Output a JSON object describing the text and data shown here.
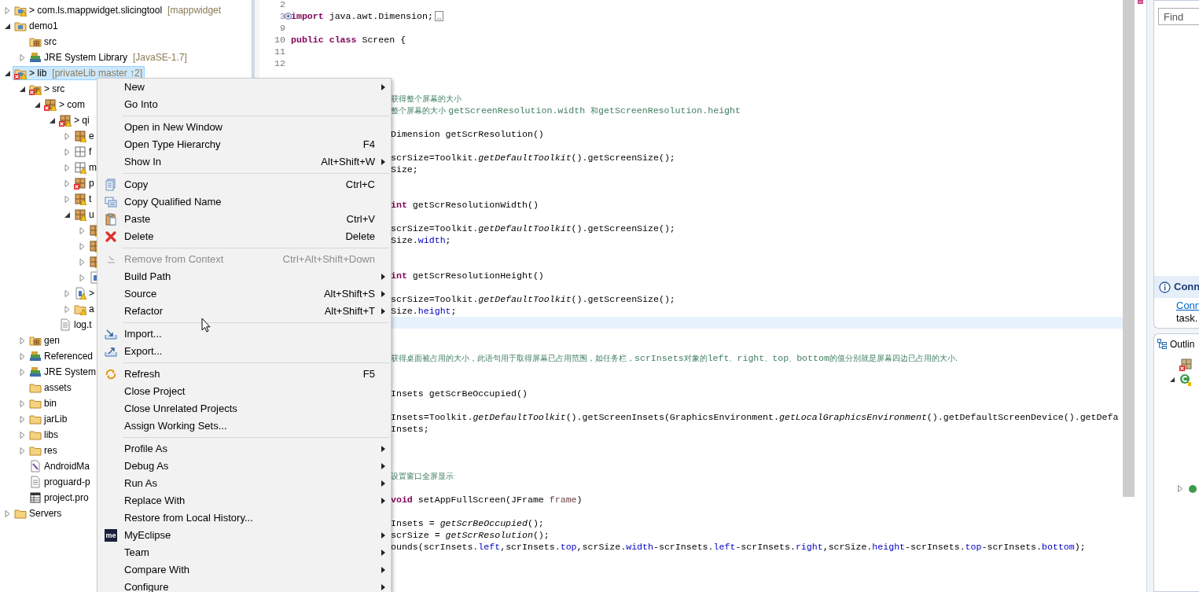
{
  "tree": {
    "items": [
      {
        "label": "> com.ls.mappwidget.slicingtool",
        "decoration": "[mappwidget",
        "kind": "project",
        "expandable": true,
        "expanded": false,
        "selected": false,
        "error": false,
        "warning": true
      },
      {
        "label": "demo1",
        "kind": "project",
        "expandable": true,
        "expanded": true,
        "selected": false,
        "error": false,
        "warning": false,
        "children": [
          {
            "label": "src",
            "kind": "source-folder",
            "expandable": false,
            "expanded": false,
            "selected": false,
            "error": false,
            "warning": false
          },
          {
            "label": "JRE System Library",
            "decoration": "[JavaSE-1.7]",
            "kind": "library",
            "expandable": true,
            "expanded": false,
            "selected": false,
            "error": false,
            "warning": false
          }
        ]
      },
      {
        "label": "> lib",
        "decoration": "[privateLib master ↑2]",
        "kind": "project",
        "expandable": true,
        "expanded": true,
        "selected": true,
        "error": true,
        "warning": true,
        "children": [
          {
            "label": "> src",
            "kind": "source-folder",
            "expandable": true,
            "expanded": true,
            "selected": false,
            "error": true,
            "warning": true,
            "children": [
              {
                "label": "> com",
                "kind": "package",
                "expandable": true,
                "expanded": true,
                "selected": false,
                "error": true,
                "warning": true,
                "children": [
                  {
                    "label": "> qi",
                    "kind": "package",
                    "expandable": true,
                    "expanded": true,
                    "selected": false,
                    "error": true,
                    "warning": true,
                    "children": [
                      {
                        "label": "e",
                        "kind": "package",
                        "expandable": true,
                        "expanded": false,
                        "selected": false,
                        "error": false,
                        "warning": true
                      },
                      {
                        "label": "f",
                        "kind": "empty-package",
                        "expandable": true,
                        "expanded": false,
                        "selected": false,
                        "error": false,
                        "warning": false
                      },
                      {
                        "label": "m",
                        "kind": "empty-package",
                        "expandable": true,
                        "expanded": false,
                        "selected": false,
                        "error": false,
                        "warning": true
                      },
                      {
                        "label": "p",
                        "kind": "package",
                        "expandable": true,
                        "expanded": false,
                        "selected": false,
                        "error": true,
                        "warning": false
                      },
                      {
                        "label": "t",
                        "kind": "package",
                        "expandable": true,
                        "expanded": false,
                        "selected": false,
                        "error": false,
                        "warning": true
                      },
                      {
                        "label": "u",
                        "kind": "package",
                        "expandable": true,
                        "expanded": true,
                        "selected": false,
                        "error": false,
                        "warning": true,
                        "children": [
                          {
                            "kind": "package",
                            "expandable": true,
                            "expanded": false,
                            "selected": false,
                            "error": false,
                            "warning": true
                          },
                          {
                            "kind": "package",
                            "expandable": true,
                            "expanded": false,
                            "selected": false,
                            "error": false,
                            "warning": true
                          },
                          {
                            "kind": "package",
                            "expandable": true,
                            "expanded": false,
                            "selected": false,
                            "error": false,
                            "warning": true
                          },
                          {
                            "kind": "java-file",
                            "expandable": true,
                            "expanded": false,
                            "selected": false,
                            "error": false,
                            "warning": false
                          }
                        ]
                      },
                      {
                        "label": ">",
                        "kind": "java-file",
                        "expandable": true,
                        "expanded": false,
                        "selected": false,
                        "error": false,
                        "warning": true
                      },
                      {
                        "label": "a",
                        "kind": "folder",
                        "expandable": true,
                        "expanded": false,
                        "selected": false,
                        "error": false,
                        "warning": true
                      }
                    ]
                  },
                  {
                    "label": "log.t",
                    "kind": "file",
                    "expandable": false,
                    "expanded": false,
                    "selected": false,
                    "error": false,
                    "warning": false
                  }
                ]
              }
            ]
          },
          {
            "label": "gen",
            "kind": "source-folder",
            "expandable": true,
            "expanded": false,
            "selected": false,
            "error": false,
            "warning": false
          },
          {
            "label": "Referenced",
            "kind": "library",
            "expandable": true,
            "expanded": false,
            "selected": false,
            "error": false,
            "warning": false
          },
          {
            "label": "JRE System",
            "kind": "library",
            "expandable": true,
            "expanded": false,
            "selected": false,
            "error": false,
            "warning": false
          },
          {
            "label": "assets",
            "kind": "folder",
            "expandable": false,
            "expanded": false,
            "selected": false,
            "error": false,
            "warning": false
          },
          {
            "label": "bin",
            "kind": "folder",
            "expandable": true,
            "expanded": false,
            "selected": false,
            "error": false,
            "warning": false
          },
          {
            "label": "jarLib",
            "kind": "folder",
            "expandable": true,
            "expanded": false,
            "selected": false,
            "error": false,
            "warning": false
          },
          {
            "label": "libs",
            "kind": "folder",
            "expandable": true,
            "expanded": false,
            "selected": false,
            "error": false,
            "warning": false
          },
          {
            "label": "res",
            "kind": "folder",
            "expandable": true,
            "expanded": false,
            "selected": false,
            "error": false,
            "warning": false
          },
          {
            "label": "AndroidMa",
            "kind": "xml-file",
            "expandable": false,
            "expanded": false,
            "selected": false,
            "error": false,
            "warning": false
          },
          {
            "label": "proguard-p",
            "kind": "file",
            "expandable": false,
            "expanded": false,
            "selected": false,
            "error": false,
            "warning": false
          },
          {
            "label": "project.pro",
            "kind": "properties-file",
            "expandable": false,
            "expanded": false,
            "selected": false,
            "error": false,
            "warning": false
          }
        ]
      },
      {
        "label": "Servers",
        "kind": "folder",
        "expandable": true,
        "expanded": false,
        "selected": false,
        "error": false,
        "warning": false
      }
    ]
  },
  "editor": {
    "rows": [
      {
        "kind": "text",
        "number": "2"
      },
      {
        "kind": "folded",
        "number": "3",
        "code": [
          {
            "text": "import",
            "kind": "keyword"
          },
          {
            "text": " java.awt.Dimension;",
            "kind": "plain"
          }
        ]
      },
      {
        "kind": "text",
        "number": "9"
      },
      {
        "kind": "text",
        "number": "10",
        "code": [
          {
            "text": "public",
            "kind": "keyword"
          },
          {
            "text": " class",
            "kind": "keyword"
          },
          {
            "text": " Screen {",
            "kind": "plain"
          }
        ]
      },
      {
        "kind": "text",
        "number": "11"
      },
      {
        "kind": "text",
        "number": "12"
      },
      {
        "kind": "text"
      },
      {
        "kind": "text"
      },
      {
        "kind": "text",
        "code": [
          {
            "text": "获得整个屏幕的大小",
            "kind": "comment-cjk"
          }
        ]
      },
      {
        "kind": "text",
        "code": [
          {
            "text": "整个屏幕的大小 ",
            "kind": "comment-cjk"
          },
          {
            "text": "getScreenResolution.width ",
            "kind": "comment"
          },
          {
            "text": "和",
            "kind": "comment-cjk"
          },
          {
            "text": "getScreenResolution.height",
            "kind": "comment"
          }
        ]
      },
      {
        "kind": "text"
      },
      {
        "kind": "text",
        "code": [
          {
            "text": "Dimension getScrResolution()",
            "kind": "plain"
          }
        ]
      },
      {
        "kind": "text"
      },
      {
        "kind": "text",
        "code": [
          {
            "text": "scrSize=Toolkit.",
            "kind": "plain"
          },
          {
            "text": "getDefaultToolkit",
            "kind": "static-call"
          },
          {
            "text": "().getScreenSize();",
            "kind": "plain"
          }
        ]
      },
      {
        "kind": "text",
        "code": [
          {
            "text": "Size;",
            "kind": "plain"
          }
        ]
      },
      {
        "kind": "text"
      },
      {
        "kind": "text"
      },
      {
        "kind": "text",
        "code": [
          {
            "text": "int",
            "kind": "keyword"
          },
          {
            "text": " getScrResolutionWidth()",
            "kind": "plain"
          }
        ]
      },
      {
        "kind": "text"
      },
      {
        "kind": "text",
        "code": [
          {
            "text": "scrSize=Toolkit.",
            "kind": "plain"
          },
          {
            "text": "getDefaultToolkit",
            "kind": "static-call"
          },
          {
            "text": "().getScreenSize();",
            "kind": "plain"
          }
        ]
      },
      {
        "kind": "text",
        "code": [
          {
            "text": "Size.",
            "kind": "plain"
          },
          {
            "text": "width",
            "kind": "field"
          },
          {
            "text": ";",
            "kind": "plain"
          }
        ]
      },
      {
        "kind": "text"
      },
      {
        "kind": "text"
      },
      {
        "kind": "text",
        "code": [
          {
            "text": "int",
            "kind": "keyword"
          },
          {
            "text": " getScrResolutionHeight()",
            "kind": "plain"
          }
        ]
      },
      {
        "kind": "text"
      },
      {
        "kind": "text",
        "code": [
          {
            "text": "scrSize=Toolkit.",
            "kind": "plain"
          },
          {
            "text": "getDefaultToolkit",
            "kind": "static-call"
          },
          {
            "text": "().getScreenSize();",
            "kind": "plain"
          }
        ]
      },
      {
        "kind": "text",
        "code": [
          {
            "text": "Size.",
            "kind": "plain"
          },
          {
            "text": "height",
            "kind": "field"
          },
          {
            "text": ";",
            "kind": "plain"
          }
        ]
      },
      {
        "kind": "current"
      },
      {
        "kind": "text"
      },
      {
        "kind": "text"
      },
      {
        "kind": "text",
        "code": [
          {
            "text": "获得桌面被占用的大小，此语句用于取得屏幕已占用范围，如任务栏，",
            "kind": "comment-cjk"
          },
          {
            "text": "scrInsets",
            "kind": "comment"
          },
          {
            "text": "对象的",
            "kind": "comment-cjk"
          },
          {
            "text": "left",
            "kind": "comment"
          },
          {
            "text": "、",
            "kind": "comment-cjk"
          },
          {
            "text": "right",
            "kind": "comment"
          },
          {
            "text": "、",
            "kind": "comment-cjk"
          },
          {
            "text": "top",
            "kind": "comment"
          },
          {
            "text": "、",
            "kind": "comment-cjk"
          },
          {
            "text": "bottom",
            "kind": "comment"
          },
          {
            "text": "的值分别就是屏幕四边已占用的大小.",
            "kind": "comment-cjk"
          }
        ]
      },
      {
        "kind": "text"
      },
      {
        "kind": "text"
      },
      {
        "kind": "text",
        "code": [
          {
            "text": "Insets getScrBeOccupied()",
            "kind": "plain"
          }
        ]
      },
      {
        "kind": "text"
      },
      {
        "kind": "text",
        "code": [
          {
            "text": "Insets=Toolkit.",
            "kind": "plain"
          },
          {
            "text": "getDefaultToolkit",
            "kind": "static-call"
          },
          {
            "text": "().getScreenInsets(GraphicsEnvironment.",
            "kind": "plain"
          },
          {
            "text": "getLocalGraphicsEnvironment",
            "kind": "static-call"
          },
          {
            "text": "().getDefaultScreenDevice().getDefa",
            "kind": "plain"
          }
        ]
      },
      {
        "kind": "text",
        "code": [
          {
            "text": "Insets;",
            "kind": "plain"
          }
        ]
      },
      {
        "kind": "text"
      },
      {
        "kind": "text"
      },
      {
        "kind": "text"
      },
      {
        "kind": "text",
        "code": [
          {
            "text": "设置窗口全屏显示",
            "kind": "comment-cjk"
          }
        ]
      },
      {
        "kind": "text"
      },
      {
        "kind": "text",
        "code": [
          {
            "text": "void",
            "kind": "keyword"
          },
          {
            "text": " setAppFullScreen(JFrame ",
            "kind": "plain"
          },
          {
            "text": "frame",
            "kind": "param"
          },
          {
            "text": ")",
            "kind": "plain"
          }
        ]
      },
      {
        "kind": "text"
      },
      {
        "kind": "text",
        "code": [
          {
            "text": "Insets = ",
            "kind": "plain"
          },
          {
            "text": "getScrBeOccupied",
            "kind": "static-call"
          },
          {
            "text": "();",
            "kind": "plain"
          }
        ]
      },
      {
        "kind": "text",
        "code": [
          {
            "text": "scrSize = ",
            "kind": "plain"
          },
          {
            "text": "getScrResolution",
            "kind": "static-call"
          },
          {
            "text": "();",
            "kind": "plain"
          }
        ]
      },
      {
        "kind": "text",
        "code": [
          {
            "text": "ounds(scrInsets.",
            "kind": "plain"
          },
          {
            "text": "left",
            "kind": "field"
          },
          {
            "text": ",scrInsets.",
            "kind": "plain"
          },
          {
            "text": "top",
            "kind": "field"
          },
          {
            "text": ",scrSize.",
            "kind": "plain"
          },
          {
            "text": "width",
            "kind": "field"
          },
          {
            "text": "-scrInsets.",
            "kind": "plain"
          },
          {
            "text": "left",
            "kind": "field"
          },
          {
            "text": "-scrInsets.",
            "kind": "plain"
          },
          {
            "text": "right",
            "kind": "field"
          },
          {
            "text": ",scrSize.",
            "kind": "plain"
          },
          {
            "text": "height",
            "kind": "field"
          },
          {
            "text": "-scrInsets.",
            "kind": "plain"
          },
          {
            "text": "top",
            "kind": "field"
          },
          {
            "text": "-scrInsets.",
            "kind": "plain"
          },
          {
            "text": "bottom",
            "kind": "field"
          },
          {
            "text": ");",
            "kind": "plain"
          }
        ]
      }
    ]
  },
  "context_menu": {
    "groups": [
      [
        {
          "label": "New",
          "kind": "plain",
          "submenu": true,
          "disabled": false
        },
        {
          "label": "Go Into",
          "kind": "plain",
          "submenu": false,
          "disabled": false
        }
      ],
      [
        {
          "label": "Open in New Window",
          "kind": "plain",
          "submenu": false,
          "disabled": false
        },
        {
          "label": "Open Type Hierarchy",
          "shortcut": "F4",
          "kind": "plain",
          "submenu": false,
          "disabled": false
        },
        {
          "label": "Show In",
          "shortcut": "Alt+Shift+W",
          "kind": "plain",
          "submenu": true,
          "disabled": false
        }
      ],
      [
        {
          "label": "Copy",
          "shortcut": "Ctrl+C",
          "kind": "copy",
          "submenu": false,
          "disabled": false
        },
        {
          "label": "Copy Qualified Name",
          "kind": "copy-qualified",
          "submenu": false,
          "disabled": false
        },
        {
          "label": "Paste",
          "shortcut": "Ctrl+V",
          "kind": "paste",
          "submenu": false,
          "disabled": false
        },
        {
          "label": "Delete",
          "shortcut": "Delete",
          "kind": "delete",
          "submenu": false,
          "disabled": false
        }
      ],
      [
        {
          "label": "Remove from Context",
          "shortcut": "Ctrl+Alt+Shift+Down",
          "kind": "remove",
          "submenu": false,
          "disabled": true
        },
        {
          "label": "Build Path",
          "kind": "plain",
          "submenu": true,
          "disabled": false
        },
        {
          "label": "Source",
          "shortcut": "Alt+Shift+S",
          "kind": "plain",
          "submenu": true,
          "disabled": false
        },
        {
          "label": "Refactor",
          "shortcut": "Alt+Shift+T",
          "kind": "plain",
          "submenu": true,
          "disabled": false
        }
      ],
      [
        {
          "label": "Import...",
          "kind": "import",
          "submenu": false,
          "disabled": false
        },
        {
          "label": "Export...",
          "kind": "export",
          "submenu": false,
          "disabled": false
        }
      ],
      [
        {
          "label": "Refresh",
          "shortcut": "F5",
          "kind": "refresh",
          "submenu": false,
          "disabled": false
        },
        {
          "label": "Close Project",
          "kind": "plain",
          "submenu": false,
          "disabled": false
        },
        {
          "label": "Close Unrelated Projects",
          "kind": "plain",
          "submenu": false,
          "disabled": false
        },
        {
          "label": "Assign Working Sets...",
          "kind": "plain",
          "submenu": false,
          "disabled": false
        }
      ],
      [
        {
          "label": "Profile As",
          "kind": "plain",
          "submenu": true,
          "disabled": false
        },
        {
          "label": "Debug As",
          "kind": "plain",
          "submenu": true,
          "disabled": false
        },
        {
          "label": "Run As",
          "kind": "plain",
          "submenu": true,
          "disabled": false
        },
        {
          "label": "Replace With",
          "kind": "plain",
          "submenu": true,
          "disabled": false
        },
        {
          "label": "Restore from Local History...",
          "kind": "plain",
          "submenu": false,
          "disabled": false
        },
        {
          "label": "MyEclipse",
          "kind": "badge",
          "badge_text": "me",
          "submenu": true,
          "disabled": false
        },
        {
          "label": "Team",
          "kind": "plain",
          "submenu": true,
          "disabled": false
        },
        {
          "label": "Compare With",
          "kind": "plain",
          "submenu": true,
          "disabled": false
        },
        {
          "label": "Configure",
          "kind": "plain",
          "submenu": true,
          "disabled": false
        }
      ]
    ]
  },
  "right_panel": {
    "find": {
      "placeholder": "Find"
    },
    "notice": {
      "title": "Conn",
      "link": "Conn",
      "text": "task."
    },
    "outline": {
      "title": "Outlin",
      "items": [
        {
          "kind": "package",
          "error": true,
          "expandable": false,
          "expanded": false
        },
        {
          "kind": "class",
          "error": false,
          "expandable": true,
          "expanded": true,
          "children": [
            {
              "kind": "method",
              "error": false,
              "expandable": true,
              "expanded": false
            }
          ]
        }
      ]
    }
  }
}
